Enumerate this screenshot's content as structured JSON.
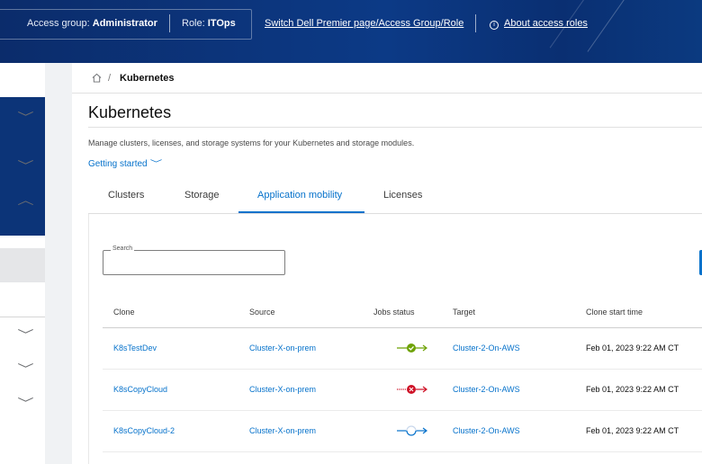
{
  "header": {
    "access_group_label": "Access group:",
    "access_group_value": "Administrator",
    "role_label": "Role:",
    "role_value": "ITOps",
    "switch_link": "Switch Dell Premier page/Access Group/Role",
    "about_link": "About access roles"
  },
  "breadcrumb": {
    "current": "Kubernetes",
    "separator": "/"
  },
  "page": {
    "title": "Kubernetes",
    "description": "Manage clusters, licenses, and storage systems for your Kubernetes and storage modules.",
    "getting_started": "Getting started"
  },
  "tabs": [
    {
      "label": "Clusters"
    },
    {
      "label": "Storage"
    },
    {
      "label": "Application mobility"
    },
    {
      "label": "Licenses"
    }
  ],
  "active_tab": "Application mobility",
  "search": {
    "label": "Search",
    "value": ""
  },
  "table": {
    "columns": [
      "Clone",
      "Source",
      "Jobs status",
      "Target",
      "Clone start time"
    ],
    "rows": [
      {
        "clone": "K8sTestDev",
        "source": "Cluster-X-on-prem",
        "status": "success",
        "target": "Cluster-2-On-AWS",
        "start": "Feb 01, 2023 9:22 AM CT"
      },
      {
        "clone": "K8sCopyCloud",
        "source": "Cluster-X-on-prem",
        "status": "failed",
        "target": "Cluster-2-On-AWS",
        "start": "Feb 01, 2023 9:22 AM CT"
      },
      {
        "clone": "K8sCopyCloud-2",
        "source": "Cluster-X-on-prem",
        "status": "in-progress",
        "target": "Cluster-2-On-AWS",
        "start": "Feb 01, 2023 9:22 AM CT"
      }
    ]
  },
  "colors": {
    "header_blue": "#0c3a86",
    "link_blue": "#0672cb",
    "success_green": "#6ea204",
    "failure_red": "#ce1126"
  }
}
